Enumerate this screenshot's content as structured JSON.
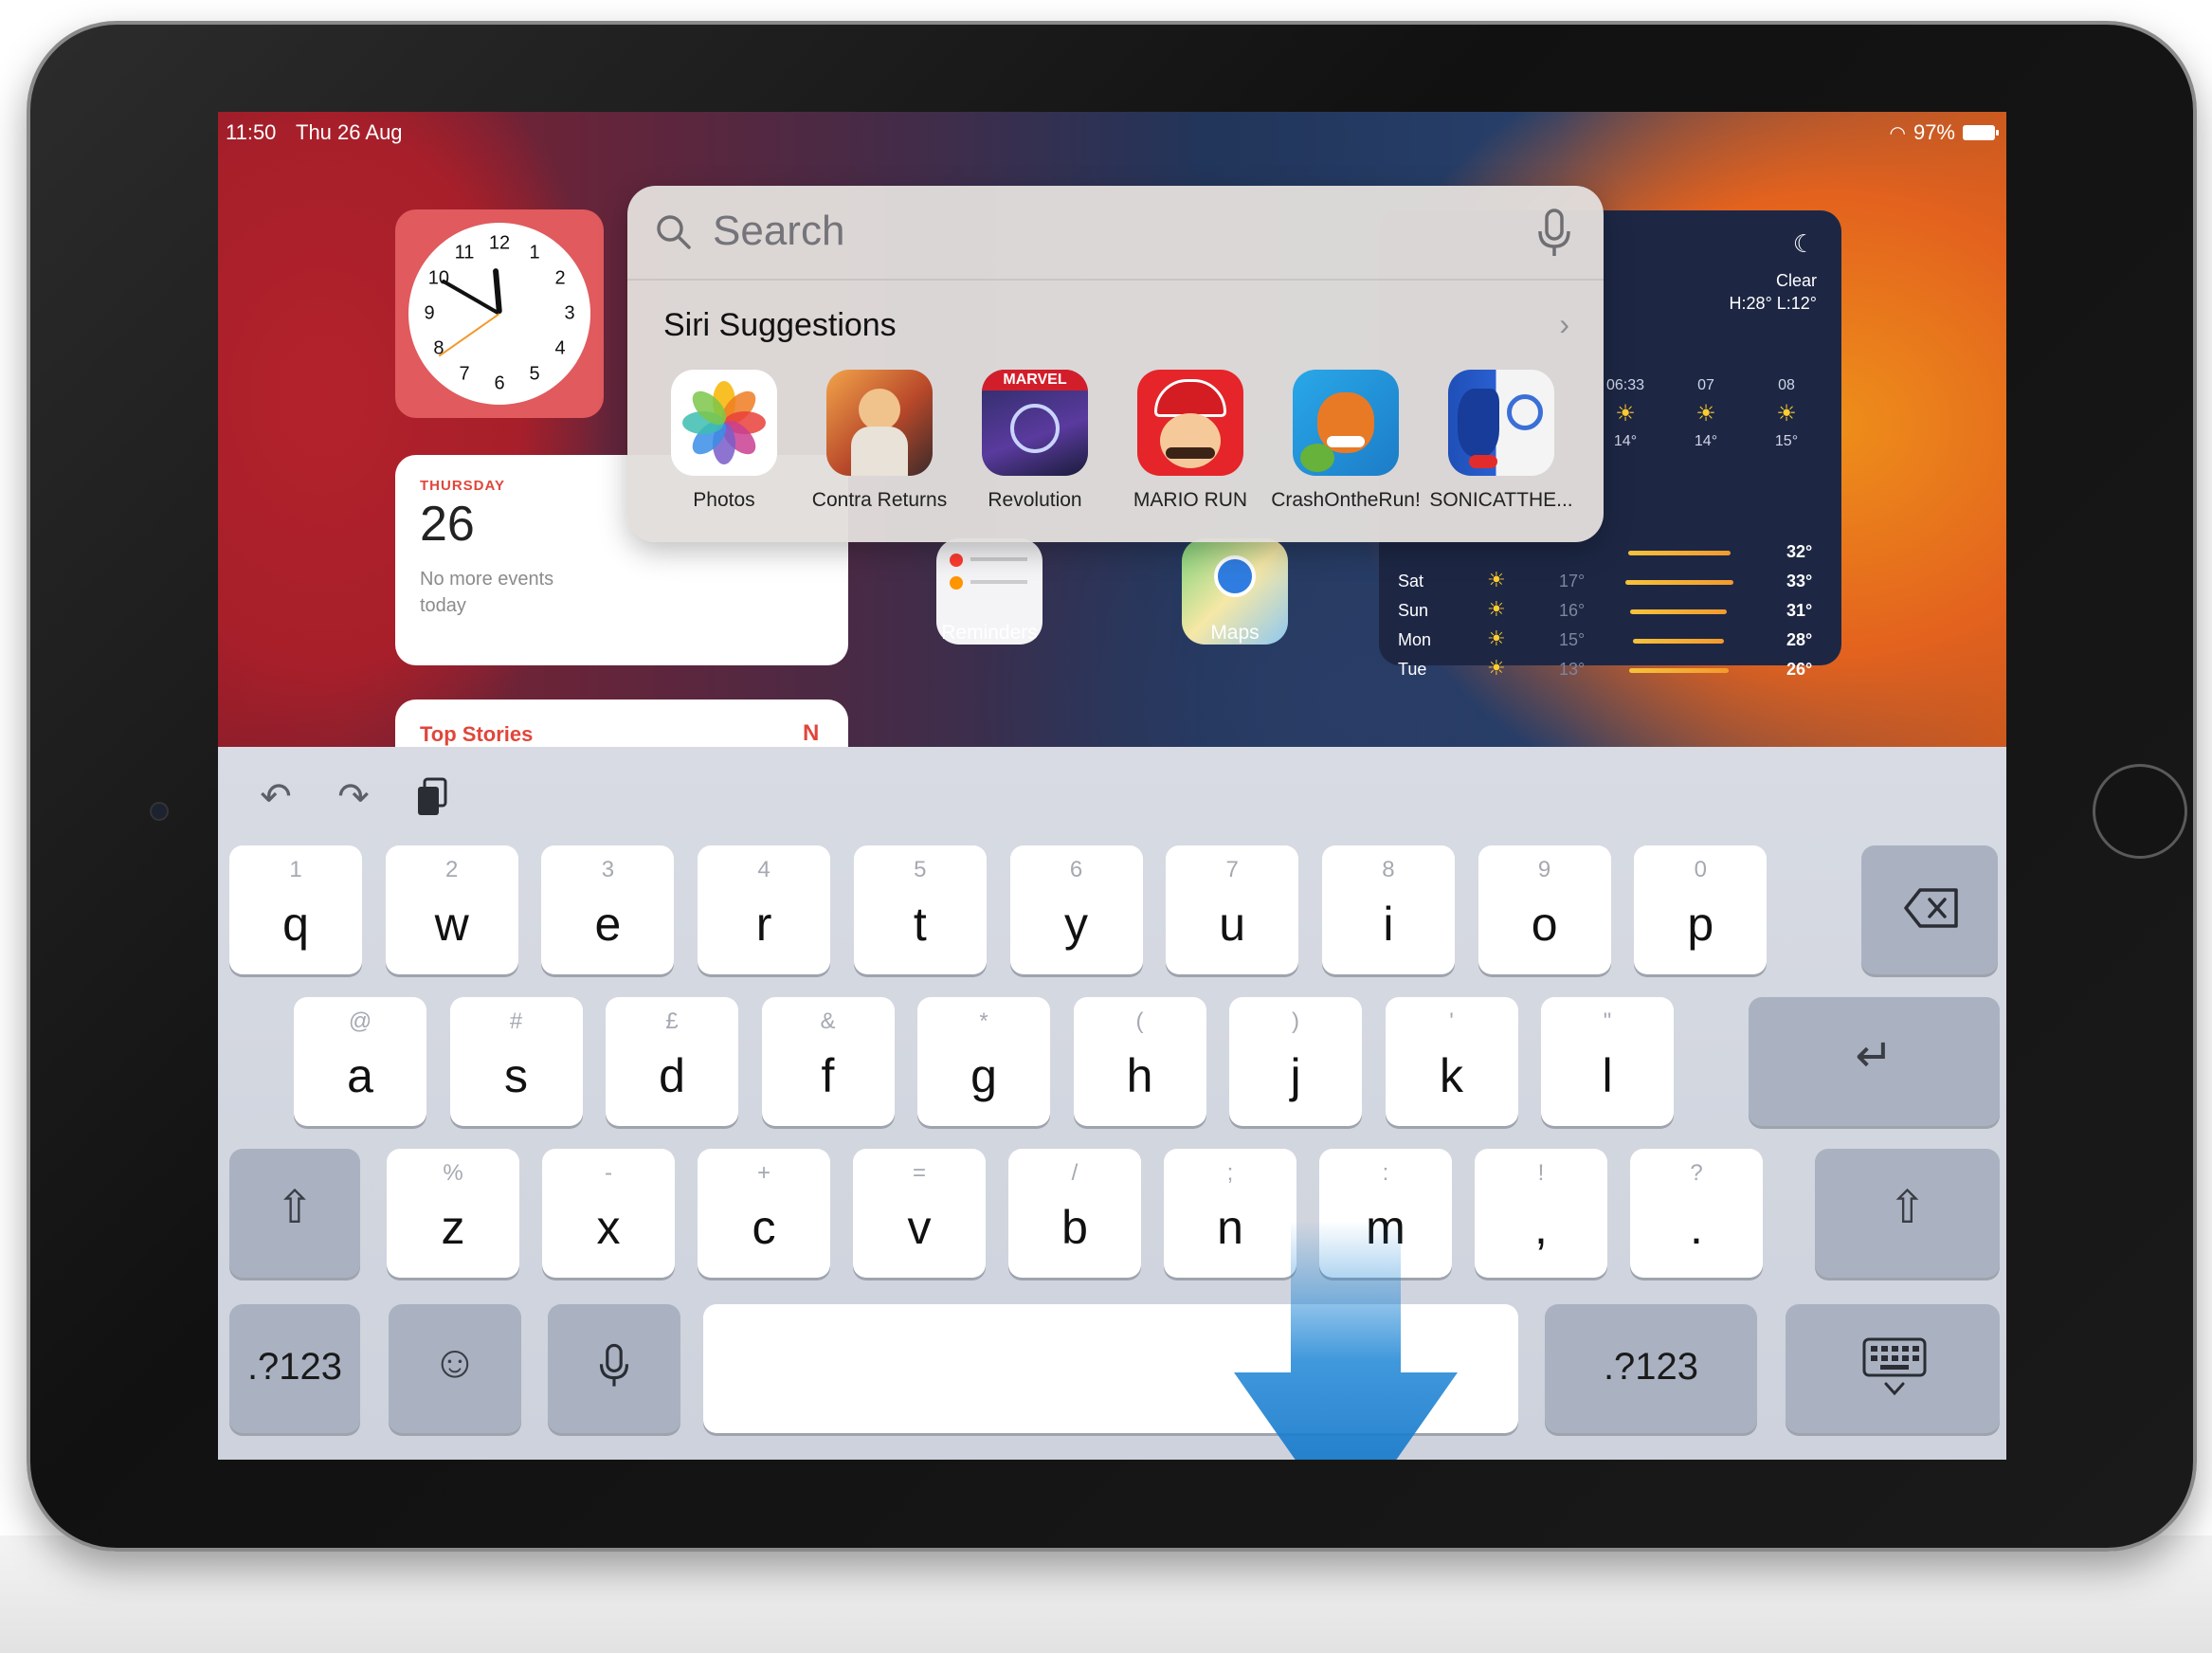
{
  "status": {
    "time": "11:50",
    "date": "Thu 26 Aug",
    "battery": "97%"
  },
  "clock_widget": {
    "numbers": [
      "12",
      "1",
      "2",
      "3",
      "4",
      "5",
      "6",
      "7",
      "8",
      "9",
      "10",
      "11"
    ]
  },
  "calendar_widget": {
    "weekday": "THURSDAY",
    "day": "26",
    "note": "No more events today"
  },
  "news_widget": {
    "title": "Top Stories"
  },
  "home_apps": [
    {
      "label": "Reminders",
      "icon": "reminders-icon"
    },
    {
      "label": "Maps",
      "icon": "maps-icon"
    }
  ],
  "weather_widget": {
    "condition": "Clear",
    "hilo": "H:28° L:12°",
    "hourly": [
      {
        "time": "06:33",
        "temp": "14°",
        "icon": "sunrise-icon"
      },
      {
        "time": "07",
        "temp": "14°",
        "icon": "sun-icon"
      },
      {
        "time": "08",
        "temp": "15°",
        "icon": "sun-icon"
      }
    ],
    "daily": [
      {
        "day": "",
        "low": "",
        "high": "32°",
        "bar": 0.72
      },
      {
        "day": "Sat",
        "low": "17°",
        "high": "33°",
        "bar": 0.76
      },
      {
        "day": "Sun",
        "low": "16°",
        "high": "31°",
        "bar": 0.68
      },
      {
        "day": "Mon",
        "low": "15°",
        "high": "28°",
        "bar": 0.64
      },
      {
        "day": "Tue",
        "low": "13°",
        "high": "26°",
        "bar": 0.7
      }
    ]
  },
  "spotlight": {
    "search_placeholder": "Search",
    "siri_title": "Siri Suggestions",
    "suggestions": [
      {
        "label": "Photos",
        "icon": "photos-icon"
      },
      {
        "label": "Contra Returns",
        "icon": "contra-icon"
      },
      {
        "label": "Revolution",
        "icon": "revolution-icon"
      },
      {
        "label": "MARIO RUN",
        "icon": "mario-icon"
      },
      {
        "label": "CrashOntheRun!",
        "icon": "crash-icon"
      },
      {
        "label": "SONICATTHE...",
        "icon": "sonic-icon"
      }
    ]
  },
  "keyboard": {
    "row1": [
      {
        "main": "q",
        "sub": "1"
      },
      {
        "main": "w",
        "sub": "2"
      },
      {
        "main": "e",
        "sub": "3"
      },
      {
        "main": "r",
        "sub": "4"
      },
      {
        "main": "t",
        "sub": "5"
      },
      {
        "main": "y",
        "sub": "6"
      },
      {
        "main": "u",
        "sub": "7"
      },
      {
        "main": "i",
        "sub": "8"
      },
      {
        "main": "o",
        "sub": "9"
      },
      {
        "main": "p",
        "sub": "0"
      }
    ],
    "row2": [
      {
        "main": "a",
        "sub": "@"
      },
      {
        "main": "s",
        "sub": "#"
      },
      {
        "main": "d",
        "sub": "£"
      },
      {
        "main": "f",
        "sub": "&"
      },
      {
        "main": "g",
        "sub": "*"
      },
      {
        "main": "h",
        "sub": "("
      },
      {
        "main": "j",
        "sub": ")"
      },
      {
        "main": "k",
        "sub": "'"
      },
      {
        "main": "l",
        "sub": "\""
      }
    ],
    "row3": [
      {
        "main": "z",
        "sub": "%"
      },
      {
        "main": "x",
        "sub": "-"
      },
      {
        "main": "c",
        "sub": "+"
      },
      {
        "main": "v",
        "sub": "="
      },
      {
        "main": "b",
        "sub": "/"
      },
      {
        "main": "n",
        "sub": ";"
      },
      {
        "main": "m",
        "sub": ":"
      },
      {
        "main": ",",
        "sub": "!"
      },
      {
        "main": ".",
        "sub": "?"
      }
    ],
    "numbers_label": ".?123",
    "right_numbers_label": ".?123"
  },
  "colors": {
    "keyboard_bg": "#d3d7df",
    "arrow": "#1f86d6",
    "accent_red": "#e0463b"
  }
}
